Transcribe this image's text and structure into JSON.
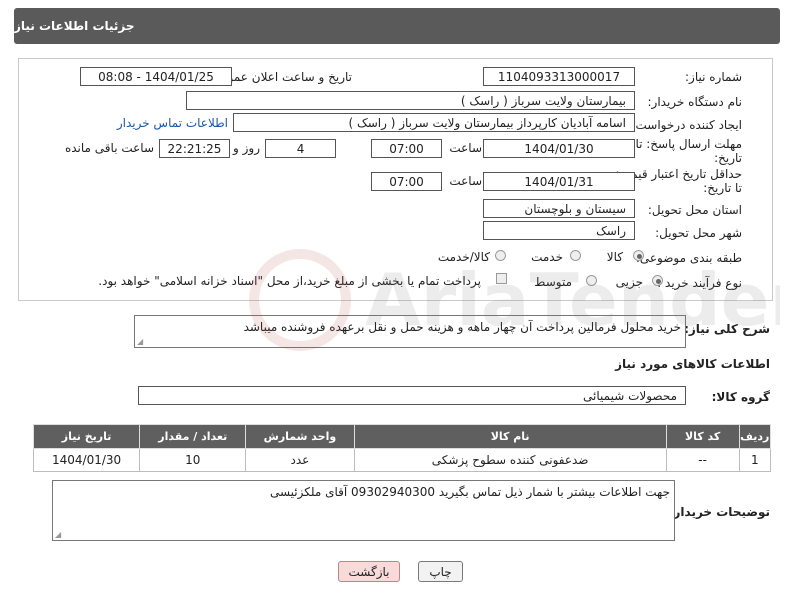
{
  "header": {
    "title": "جزئیات اطلاعات نیاز"
  },
  "form": {
    "need_number_label": "شماره نیاز:",
    "need_number": "1104093313000017",
    "announce_label": "تاریخ و ساعت اعلان عمومی:",
    "announce_value": "1404/01/25 - 08:08",
    "buyer_org_label": "نام دستگاه خریدار:",
    "buyer_org": "بیمارستان ولایت سرباز ( راسک )",
    "requester_label": "ایجاد کننده درخواست:",
    "requester": "اسامه آبادیان کارپرداز بیمارستان ولایت سرباز ( راسک )",
    "contact_link": "اطلاعات تماس خریدار",
    "deadline_label_1": "مهلت ارسال پاسخ: تا",
    "deadline_label_2": "تاریخ:",
    "deadline_date": "1404/01/30",
    "time_label": "ساعت",
    "deadline_time": "07:00",
    "days_value": "4",
    "days_label": "روز و",
    "remaining_time": "22:21:25",
    "remaining_label": "ساعت باقی مانده",
    "validity_label_1": "حداقل تاریخ اعتبار قیمت:",
    "validity_label_2": "تا تاریخ:",
    "validity_date": "1404/01/31",
    "validity_time": "07:00",
    "province_label": "استان محل تحویل:",
    "province": "سیستان و بلوچستان",
    "city_label": "شهر محل تحویل:",
    "city": "راسک",
    "category_label": "طبقه بندی موضوعی:",
    "category_options": [
      "کالا",
      "خدمت",
      "کالا/خدمت"
    ],
    "process_label": "نوع فرآیند خرید :",
    "process_options": [
      "جزیی",
      "متوسط"
    ],
    "payment_note": "پرداخت تمام یا بخشی از مبلغ خرید،از محل \"اسناد خزانه اسلامی\" خواهد بود."
  },
  "description": {
    "label": "شرح کلی نیاز:",
    "text": "خرید محلول فرمالین پرداخت آن چهار ماهه و هزینه حمل و نقل برعهده فروشنده میباشد"
  },
  "goods": {
    "section_title": "اطلاعات کالاهای مورد نیاز",
    "group_label": "گروه کالا:",
    "group_value": "محصولات شیمیائی",
    "columns": [
      "ردیف",
      "کد کالا",
      "نام کالا",
      "واحد شمارش",
      "تعداد / مقدار",
      "تاریخ نیاز"
    ],
    "rows": [
      {
        "row": "1",
        "code": "--",
        "name": "ضدعفونی کننده سطوح پزشکی",
        "unit": "عدد",
        "qty": "10",
        "date": "1404/01/30"
      }
    ]
  },
  "buyer_notes": {
    "label": "توضیحات خریدار:",
    "text": "جهت اطلاعات بیشتر با شمار ذیل تماس بگیرید 09302940300 آقای ملکزئیسی"
  },
  "buttons": {
    "print": "چاپ",
    "back": "بازگشت"
  },
  "watermark": {
    "text": "AriaTender.net"
  }
}
